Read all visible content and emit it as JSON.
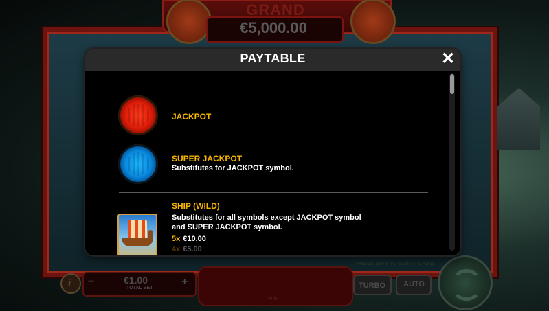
{
  "background": {
    "grand_label": "GRAND",
    "grand_value": "€5,000.00",
    "bet_value": "€1.00",
    "bet_label": "TOTAL BET",
    "minus": "−",
    "plus": "+",
    "info": "i",
    "turbo": "TURBO",
    "auto": "AUTO",
    "hint": "PRESS SPIN TO START GAME",
    "win_label": "WIN"
  },
  "paytable": {
    "title": "PAYTABLE",
    "close": "✕",
    "symbols": [
      {
        "name": "JACKPOT",
        "description": ""
      },
      {
        "name": "SUPER JACKPOT",
        "description": "Substitutes for JACKPOT symbol."
      },
      {
        "name": "SHIP (WILD)",
        "description_line1": "Substitutes for all symbols except JACKPOT symbol",
        "description_line2": "and SUPER JACKPOT symbol.",
        "pays": [
          {
            "mult": "5x",
            "value": "€10.00"
          },
          {
            "mult": "4x",
            "value": "€5.00"
          }
        ]
      }
    ]
  },
  "colors": {
    "accent": "#f7b500",
    "modal_bg": "#000000",
    "header_bg": "#2a2a2a"
  }
}
